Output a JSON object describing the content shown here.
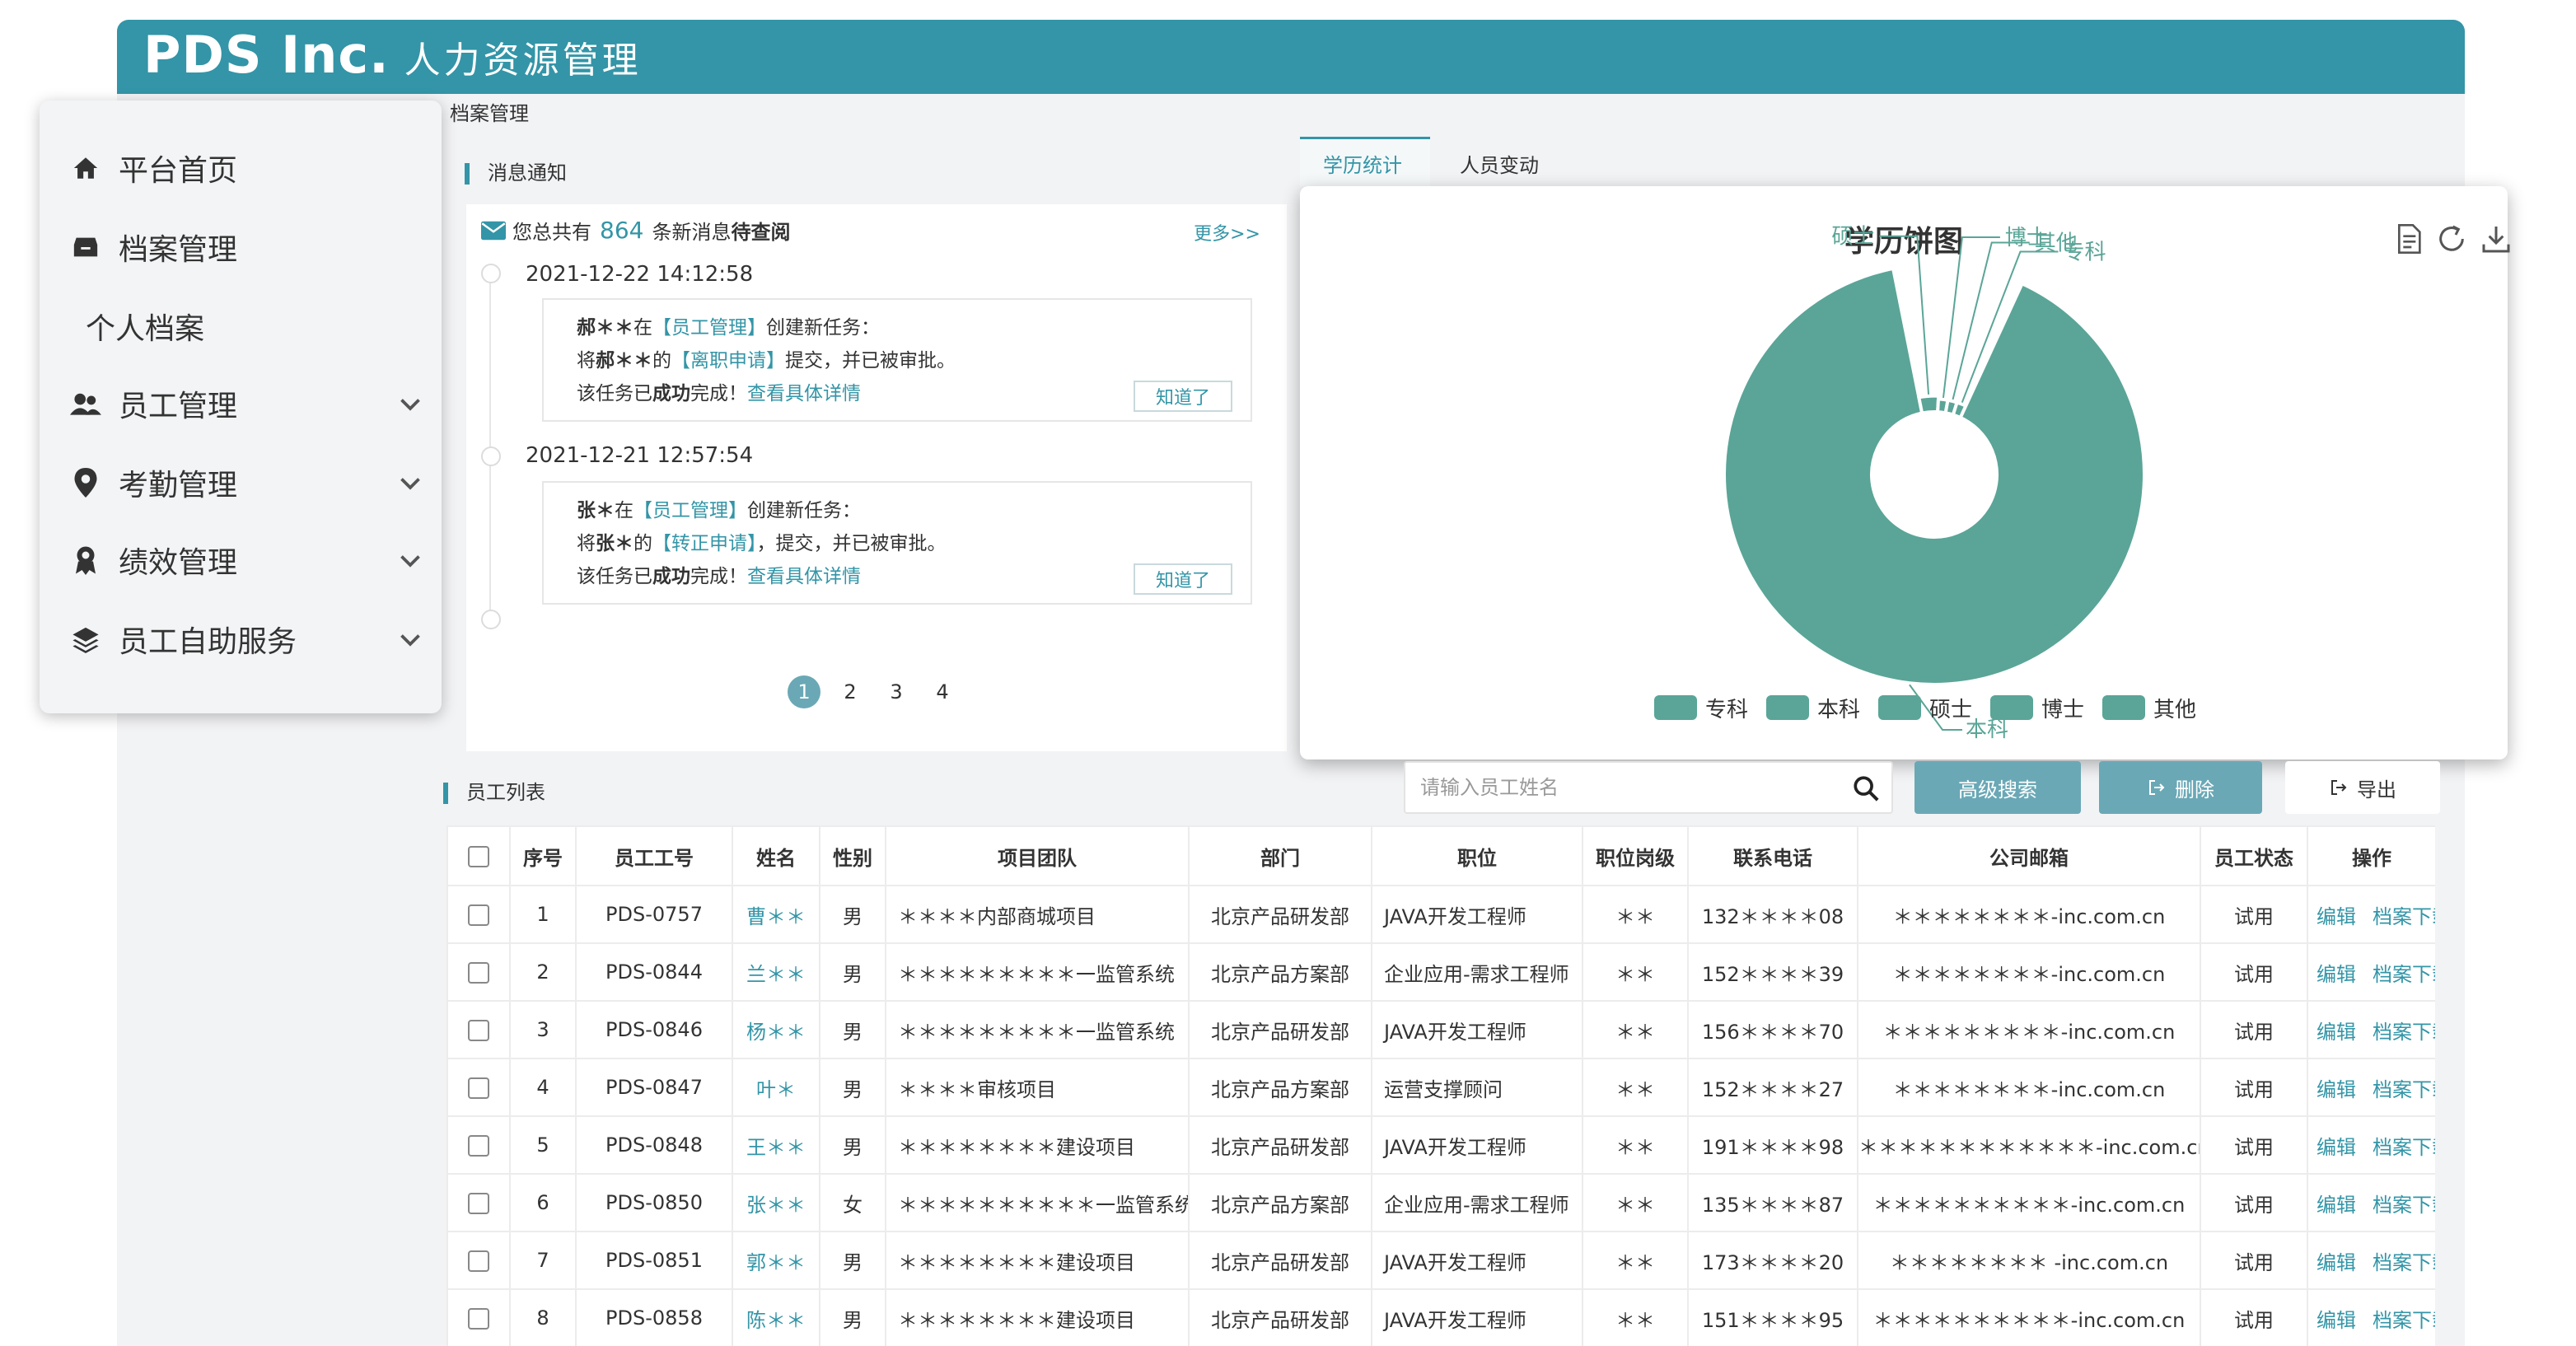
{
  "header": {
    "brand": "PDS Inc.",
    "subtitle": "人力资源管理"
  },
  "breadcrumb": "档案管理",
  "sidebar": {
    "items": [
      {
        "label": "平台首页",
        "icon": "home-icon",
        "has_children": false
      },
      {
        "label": "档案管理",
        "icon": "archive-icon",
        "has_children": false
      },
      {
        "label": "个人档案",
        "icon": "",
        "has_children": false
      },
      {
        "label": "员工管理",
        "icon": "users-icon",
        "has_children": true
      },
      {
        "label": "考勤管理",
        "icon": "location-pin-icon",
        "has_children": true
      },
      {
        "label": "绩效管理",
        "icon": "award-icon",
        "has_children": true
      },
      {
        "label": "员工自助服务",
        "icon": "layers-icon",
        "has_children": true
      }
    ]
  },
  "messages": {
    "title": "消息通知",
    "summary_prefix": "您总共有",
    "count": "864",
    "summary_suffix": "条新消息",
    "summary_bold": "待查阅",
    "more": "更多>>",
    "items": [
      {
        "time": "2021-12-22 14:12:58",
        "l1_name": "郝＊＊",
        "l1_mid": "在",
        "l1_tag": "【员工管理】",
        "l1_end": "创建新任务：",
        "l2_pre": "将",
        "l2_name": "郝＊＊",
        "l2_mid": "的",
        "l2_tag": "【离职申请】",
        "l2_end": "提交，并已被审批。",
        "l3_pre": "该任务已",
        "l3_bold": "成功",
        "l3_mid": "完成！",
        "l3_link": "查看具体详情",
        "btn": "知道了"
      },
      {
        "time": "2021-12-21 12:57:54",
        "l1_name": "张＊",
        "l1_mid": "在",
        "l1_tag": "【员工管理】",
        "l1_end": "创建新任务：",
        "l2_pre": "将",
        "l2_name": "张＊",
        "l2_mid": "的",
        "l2_tag": "【转正申请】",
        "l2_end": "，提交，并已被审批。",
        "l3_pre": "该任务已",
        "l3_bold": "成功",
        "l3_mid": "完成！",
        "l3_link": "查看具体详情",
        "btn": "知道了"
      }
    ],
    "pages": [
      "1",
      "2",
      "3",
      "4"
    ],
    "active_page": 0
  },
  "chart_tabs": [
    {
      "label": "学历统计",
      "active": true
    },
    {
      "label": "人员变动",
      "active": false
    }
  ],
  "chart_data": {
    "type": "pie",
    "title": "学历饼图",
    "categories": [
      "专科",
      "本科",
      "硕士",
      "博士",
      "其他"
    ],
    "values": [
      2,
      90,
      4,
      2,
      2
    ],
    "color": "#5aa597",
    "legend": "bottom"
  },
  "chart_tools": [
    "document-icon",
    "refresh-icon",
    "download-icon"
  ],
  "employee_list": {
    "title": "员工列表",
    "search_placeholder": "请输入员工姓名",
    "advanced_search": "高级搜索",
    "delete": "删除",
    "export": "导出",
    "columns": [
      "序号",
      "员工工号",
      "姓名",
      "性别",
      "项目团队",
      "部门",
      "职位",
      "职位岗级",
      "联系电话",
      "公司邮箱",
      "员工状态",
      "操作"
    ],
    "rows": [
      {
        "no": "1",
        "id": "PDS-0757",
        "name": "曹＊＊",
        "gender": "男",
        "team": "＊＊＊＊内部商城项目",
        "dept": "北京产品研发部",
        "title": "JAVA开发工程师",
        "level": "＊＊",
        "phone": "132＊＊＊＊08",
        "email": "＊＊＊＊＊＊＊＊-inc.com.cn",
        "status": "试用",
        "edit": "编辑",
        "download": "档案下载"
      },
      {
        "no": "2",
        "id": "PDS-0844",
        "name": "兰＊＊",
        "gender": "男",
        "team": "＊＊＊＊＊＊＊＊＊一监管系统",
        "dept": "北京产品方案部",
        "title": "企业应用-需求工程师",
        "level": "＊＊",
        "phone": "152＊＊＊＊39",
        "email": "＊＊＊＊＊＊＊＊-inc.com.cn",
        "status": "试用",
        "edit": "编辑",
        "download": "档案下载"
      },
      {
        "no": "3",
        "id": "PDS-0846",
        "name": "杨＊＊",
        "gender": "男",
        "team": "＊＊＊＊＊＊＊＊＊一监管系统",
        "dept": "北京产品研发部",
        "title": "JAVA开发工程师",
        "level": "＊＊",
        "phone": "156＊＊＊＊70",
        "email": "＊＊＊＊＊＊＊＊＊-inc.com.cn",
        "status": "试用",
        "edit": "编辑",
        "download": "档案下载"
      },
      {
        "no": "4",
        "id": "PDS-0847",
        "name": "叶＊",
        "gender": "男",
        "team": "＊＊＊＊审核项目",
        "dept": "北京产品方案部",
        "title": "运营支撑顾问",
        "level": "＊＊",
        "phone": "152＊＊＊＊27",
        "email": "＊＊＊＊＊＊＊＊-inc.com.cn",
        "status": "试用",
        "edit": "编辑",
        "download": "档案下载"
      },
      {
        "no": "5",
        "id": "PDS-0848",
        "name": "王＊＊",
        "gender": "男",
        "team": "＊＊＊＊＊＊＊＊建设项目",
        "dept": "北京产品研发部",
        "title": "JAVA开发工程师",
        "level": "＊＊",
        "phone": "191＊＊＊＊98",
        "email": "＊＊＊＊＊＊＊＊＊＊＊＊-inc.com.cn",
        "status": "试用",
        "edit": "编辑",
        "download": "档案下载"
      },
      {
        "no": "6",
        "id": "PDS-0850",
        "name": "张＊＊",
        "gender": "女",
        "team": "＊＊＊＊＊＊＊＊＊＊一监管系统",
        "dept": "北京产品方案部",
        "title": "企业应用-需求工程师",
        "level": "＊＊",
        "phone": "135＊＊＊＊87",
        "email": "＊＊＊＊＊＊＊＊＊＊-inc.com.cn",
        "status": "试用",
        "edit": "编辑",
        "download": "档案下载"
      },
      {
        "no": "7",
        "id": "PDS-0851",
        "name": "郭＊＊",
        "gender": "男",
        "team": "＊＊＊＊＊＊＊＊建设项目",
        "dept": "北京产品研发部",
        "title": "JAVA开发工程师",
        "level": "＊＊",
        "phone": "173＊＊＊＊20",
        "email": "＊＊＊＊＊＊＊＊ -inc.com.cn",
        "status": "试用",
        "edit": "编辑",
        "download": "档案下载"
      },
      {
        "no": "8",
        "id": "PDS-0858",
        "name": "陈＊＊",
        "gender": "男",
        "team": "＊＊＊＊＊＊＊＊建设项目",
        "dept": "北京产品研发部",
        "title": "JAVA开发工程师",
        "level": "＊＊",
        "phone": "151＊＊＊＊95",
        "email": "＊＊＊＊＊＊＊＊＊＊-inc.com.cn",
        "status": "试用",
        "edit": "编辑",
        "download": "档案下载"
      }
    ]
  }
}
